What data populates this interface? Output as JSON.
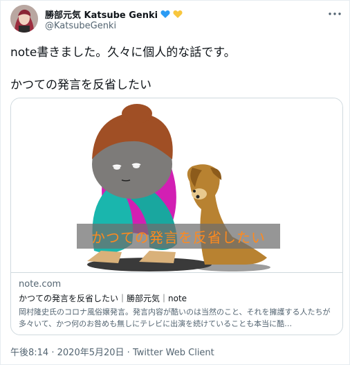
{
  "author": {
    "display_name": "勝部元気 Katsube Genki",
    "username": "@KatsubeGenki",
    "badges": [
      "blue-heart-icon",
      "yellow-heart-icon"
    ],
    "badge_colors": {
      "blue": "#2b9bf4",
      "yellow": "#f8c63d"
    }
  },
  "tweet": {
    "text_lines": [
      "note書きました。久々に個人的な話です。",
      "かつての発言を反省したい"
    ]
  },
  "card": {
    "image_overlay_text": "かつての発言を反省したい",
    "domain": "note.com",
    "title": "かつての発言を反省したい｜勝部元気｜note",
    "description": "岡村隆史氏のコロナ風俗嬢発言。発言内容が酷いのは当然のこと、それを擁護する人たちが多々いて、かつ何のお咎めも無しにテレビに出演を続けていることも本当に酷…"
  },
  "meta": {
    "time": "午後8:14",
    "separator": "·",
    "date": "2020年5月20日",
    "client": "Twitter Web Client"
  },
  "colors": {
    "text_primary": "#0f1419",
    "text_secondary": "#536471",
    "border": "#cfd9de",
    "overlay_text": "#ff8a1e"
  },
  "icons": {
    "more": "more-dots-icon"
  }
}
